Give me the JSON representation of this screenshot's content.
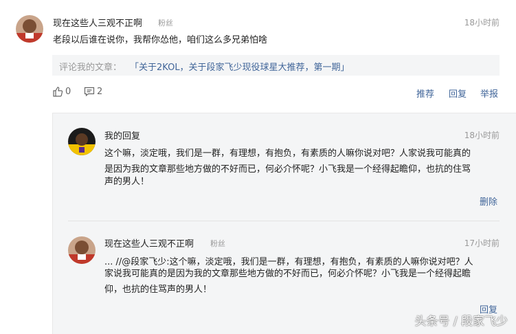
{
  "comment": {
    "username": "现在这些人三观不正啊",
    "badge": "粉丝",
    "time": "18小时前",
    "text": "老段以后谁在说你，我帮你怂他，咱们这么多兄弟怕啥",
    "quote_label": "评论我的文章：",
    "quote_link": "「关于2KOL，关于段家飞少现役球星大推荐，第一期」",
    "likes": "0",
    "replies": "2",
    "actions": {
      "recommend": "推荐",
      "reply": "回复",
      "report": "举报"
    }
  },
  "replies": [
    {
      "username": "我的回复",
      "time": "18小时前",
      "lines": [
        "这个嘛，淡定哦，我们是一群，有理想，有抱负，有素质的人嘛你说对吧？人家说我可能真的",
        "是因为我的文章那些地方做的不好而已，何必介怀呢？小飞我是一个经得起瞻仰，也抗的住骂",
        "声的男人！"
      ],
      "action": "删除"
    },
    {
      "username": "现在这些人三观不正啊",
      "badge": "粉丝",
      "time": "17小时前",
      "lines": [
        "... //@段家飞少:这个嘛，淡定哦，我们是一群，有理想，有抱负，有素质的人嘛你说对吧？人",
        "家说我可能真的是因为我的文章那些地方做的不好而已，何必介怀呢？小飞我是一个经得起瞻",
        "仰，也抗的住骂声的男人！"
      ],
      "action": "回复"
    }
  ],
  "watermark": "头条号 / 段家飞少",
  "colors": {
    "link": "#406599",
    "muted": "#999999",
    "panel": "#f4f5f6"
  }
}
